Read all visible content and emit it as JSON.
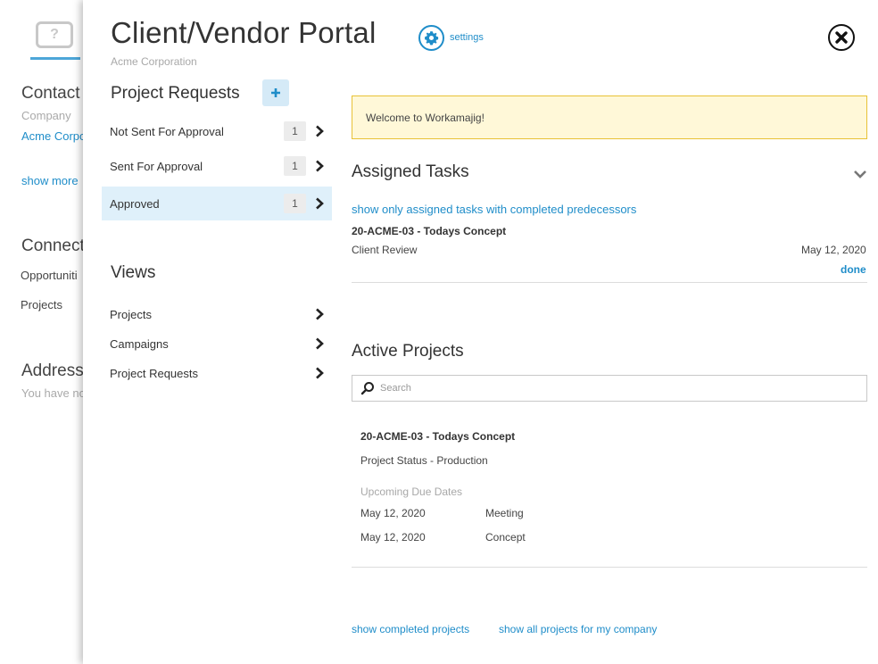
{
  "background": {
    "contact_heading": "Contact",
    "company_label": "Company",
    "company_value": "Acme Corpo",
    "show_more": "show more",
    "connect_heading": "Connect",
    "opportunities": "Opportuniti",
    "projects": "Projects",
    "address_heading": "Address",
    "address_empty": "You have no"
  },
  "portal": {
    "title": "Client/Vendor Portal",
    "company": "Acme Corporation",
    "settings_label": "settings",
    "settings_icon": "gear-icon",
    "close_icon": "close-icon"
  },
  "project_requests": {
    "heading": "Project Requests",
    "add_icon": "plus-icon",
    "items": [
      {
        "label": "Not Sent For Approval",
        "count": "1"
      },
      {
        "label": "Sent For Approval",
        "count": "1"
      },
      {
        "label": "Approved",
        "count": "1"
      }
    ]
  },
  "views": {
    "heading": "Views",
    "items": [
      {
        "label": "Projects"
      },
      {
        "label": "Campaigns"
      },
      {
        "label": "Project Requests"
      }
    ]
  },
  "welcome": "Welcome to Workamajig!",
  "assigned_tasks": {
    "heading": "Assigned Tasks",
    "filter_link": "show only assigned tasks with completed predecessors",
    "task": {
      "project": "20-ACME-03 - Todays Concept",
      "name": "Client Review",
      "date": "May 12, 2020",
      "action": "done"
    }
  },
  "active_projects": {
    "heading": "Active Projects",
    "search_placeholder": "Search",
    "project": {
      "name": "20-ACME-03 - Todays Concept",
      "status": "Project Status - Production",
      "upcoming_label": "Upcoming Due Dates",
      "due_dates": [
        {
          "date": "May 12, 2020",
          "item": "Meeting"
        },
        {
          "date": "May 12, 2020",
          "item": "Concept"
        }
      ]
    },
    "show_completed": "show completed projects",
    "show_all": "show all projects for my company"
  },
  "colors": {
    "accent": "#1f8dc9",
    "active_row": "#dff0fa",
    "welcome_bg": "#fff8d8",
    "welcome_border": "#e8c236"
  }
}
